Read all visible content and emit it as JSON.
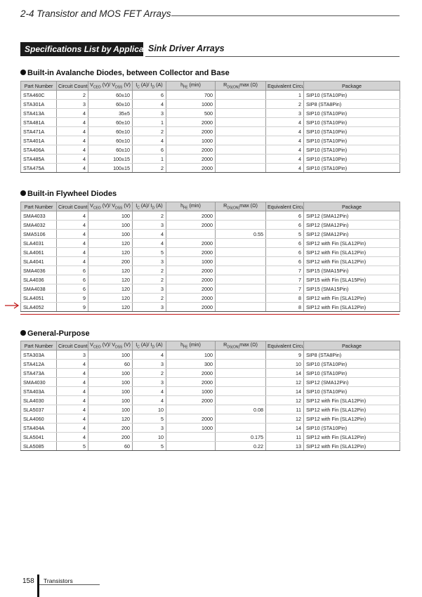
{
  "header": {
    "title": "2-4  Transistor and MOS FET Arrays"
  },
  "banner": {
    "left": "Specifications List by Application",
    "right": "Sink Driver Arrays"
  },
  "columns": [
    "Part Number",
    "Circuit Count",
    "VCEO (V)/ VDSS (V)",
    "IC (A)/ ID (A)",
    "hFE (min)",
    "RDS(ON)max (Ω)",
    "Equivalent Circuit",
    "Package"
  ],
  "sections": [
    {
      "title": "Built-in Avalanche Diodes, between Collector and Base",
      "rows": [
        [
          "STA460C",
          "2",
          "60±10",
          "6",
          "700",
          "",
          "1",
          "SIP10 (STA10Pin)"
        ],
        [
          "STA301A",
          "3",
          "60±10",
          "4",
          "1000",
          "",
          "2",
          "SIP8 (STA8Pin)"
        ],
        [
          "STA413A",
          "4",
          "35±5",
          "3",
          "500",
          "",
          "3",
          "SIP10 (STA10Pin)"
        ],
        [
          "STA481A",
          "4",
          "60±10",
          "1",
          "2000",
          "",
          "4",
          "SIP10 (STA10Pin)"
        ],
        [
          "STA471A",
          "4",
          "60±10",
          "2",
          "2000",
          "",
          "4",
          "SIP10 (STA10Pin)"
        ],
        [
          "STA401A",
          "4",
          "60±10",
          "4",
          "1000",
          "",
          "4",
          "SIP10 (STA10Pin)"
        ],
        [
          "STA406A",
          "4",
          "60±10",
          "6",
          "2000",
          "",
          "4",
          "SIP10 (STA10Pin)"
        ],
        [
          "STA485A",
          "4",
          "100±15",
          "1",
          "2000",
          "",
          "4",
          "SIP10 (STA10Pin)"
        ],
        [
          "STA475A",
          "4",
          "100±15",
          "2",
          "2000",
          "",
          "4",
          "SIP10 (STA10Pin)"
        ]
      ]
    },
    {
      "title": "Built-in Flywheel Diodes",
      "rows": [
        [
          "SMA4033",
          "4",
          "100",
          "2",
          "2000",
          "",
          "6",
          "SIP12 (SMA12Pin)"
        ],
        [
          "SMA4032",
          "4",
          "100",
          "3",
          "2000",
          "",
          "6",
          "SIP12 (SMA12Pin)"
        ],
        [
          "SMA5106",
          "4",
          "100",
          "4",
          "",
          "0.55",
          "5",
          "SIP12 (SMA12Pin)"
        ],
        [
          "SLA4031",
          "4",
          "120",
          "4",
          "2000",
          "",
          "6",
          "SIP12 with Fin (SLA12Pin)"
        ],
        [
          "SLA4061",
          "4",
          "120",
          "5",
          "2000",
          "",
          "6",
          "SIP12 with Fin (SLA12Pin)"
        ],
        [
          "SLA4041",
          "4",
          "200",
          "3",
          "1000",
          "",
          "6",
          "SIP12 with Fin (SLA12Pin)"
        ],
        [
          "SMA4036",
          "6",
          "120",
          "2",
          "2000",
          "",
          "7",
          "SIP15 (SMA15Pin)"
        ],
        [
          "SLA4036",
          "6",
          "120",
          "2",
          "2000",
          "",
          "7",
          "SIP15 with Fin (SLA15Pin)"
        ],
        [
          "SMA4038",
          "6",
          "120",
          "3",
          "2000",
          "",
          "7",
          "SIP15 (SMA15Pin)"
        ],
        [
          "SLA4051",
          "9",
          "120",
          "2",
          "2000",
          "",
          "8",
          "SIP12 with Fin (SLA12Pin)"
        ],
        [
          "SLA4052",
          "9",
          "120",
          "3",
          "2000",
          "",
          "8",
          "SIP12 with Fin (SLA12Pin)"
        ]
      ]
    },
    {
      "title": "General-Purpose",
      "rows": [
        [
          "STA303A",
          "3",
          "100",
          "4",
          "100",
          "",
          "9",
          "SIP8 (STA8Pin)"
        ],
        [
          "STA412A",
          "4",
          "60",
          "3",
          "300",
          "",
          "10",
          "SIP10 (STA10Pin)"
        ],
        [
          "STA473A",
          "4",
          "100",
          "2",
          "2000",
          "",
          "14",
          "SIP10 (STA10Pin)"
        ],
        [
          "SMA4030",
          "4",
          "100",
          "3",
          "2000",
          "",
          "12",
          "SIP12 (SMA12Pin)"
        ],
        [
          "STA403A",
          "4",
          "100",
          "4",
          "1000",
          "",
          "14",
          "SIP10 (STA10Pin)"
        ],
        [
          "SLA4030",
          "4",
          "100",
          "4",
          "2000",
          "",
          "12",
          "SIP12 with Fin (SLA12Pin)"
        ],
        [
          "SLA5037",
          "4",
          "100",
          "10",
          "",
          "0.08",
          "11",
          "SIP12 with Fin (SLA12Pin)"
        ],
        [
          "SLA4060",
          "4",
          "120",
          "5",
          "2000",
          "",
          "12",
          "SIP12 with Fin (SLA12Pin)"
        ],
        [
          "STA404A",
          "4",
          "200",
          "3",
          "1000",
          "",
          "14",
          "SIP10 (STA10Pin)"
        ],
        [
          "SLA5041",
          "4",
          "200",
          "10",
          "",
          "0.175",
          "11",
          "SIP12 with Fin (SLA12Pin)"
        ],
        [
          "SLA5085",
          "5",
          "60",
          "5",
          "",
          "0.22",
          "13",
          "SIP12 with Fin (SLA12Pin)"
        ]
      ]
    }
  ],
  "footer": {
    "page": "158",
    "label": "Transistors"
  },
  "colors": {
    "highlight_line": "#c01818",
    "header_fill": "#d2d2d2",
    "banner_fill": "#1b1b1b"
  }
}
